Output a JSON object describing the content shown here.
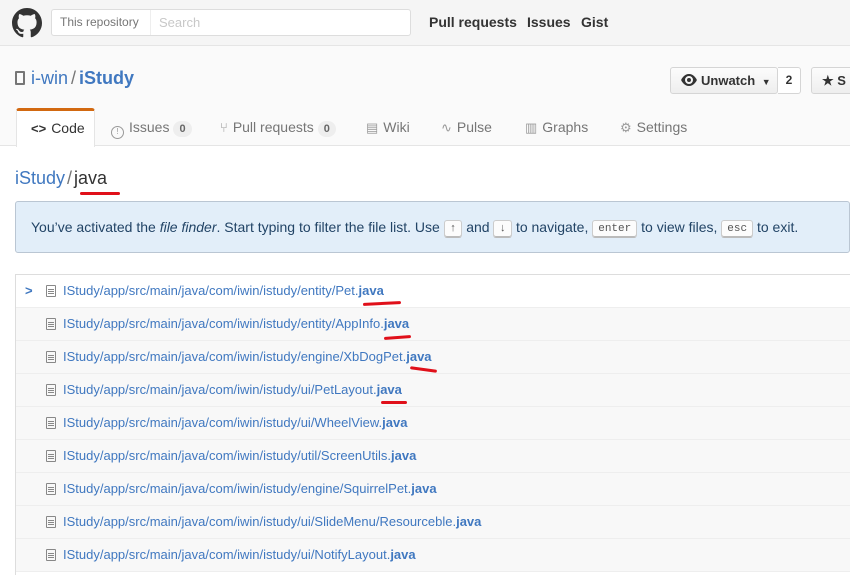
{
  "header": {
    "search_scope": "This repository",
    "search_placeholder": "Search",
    "nav": [
      "Pull requests",
      "Issues",
      "Gist"
    ]
  },
  "repo": {
    "owner": "i-win",
    "separator": "/",
    "name": "iStudy",
    "unwatch_label": "Unwatch",
    "watch_count": "2",
    "star_label": "S"
  },
  "tabs": [
    {
      "label": "Code",
      "icon": "code-icon",
      "selected": true
    },
    {
      "label": "Issues",
      "icon": "issue-icon",
      "count": "0"
    },
    {
      "label": "Pull requests",
      "icon": "pull-request-icon",
      "count": "0"
    },
    {
      "label": "Wiki",
      "icon": "book-icon"
    },
    {
      "label": "Pulse",
      "icon": "pulse-icon"
    },
    {
      "label": "Graphs",
      "icon": "graph-icon"
    },
    {
      "label": "Settings",
      "icon": "gear-icon"
    }
  ],
  "finder": {
    "repo": "iStudy",
    "separator": "/",
    "query": "java"
  },
  "flash": {
    "t1": "You’ve activated the ",
    "t2": "file finder",
    "t3": ". Start typing to filter the file list. Use ",
    "k_up": "↑",
    "t4": " and ",
    "k_down": "↓",
    "t5": " to navigate, ",
    "k_enter": "enter",
    "t6": " to view files, ",
    "k_esc": "esc",
    "t7": " to exit."
  },
  "files": [
    {
      "prefix": "IStudy/app/src/main/java/com/iwin/istudy/entity/Pet.",
      "match": "java"
    },
    {
      "prefix": "IStudy/app/src/main/java/com/iwin/istudy/entity/AppInfo.",
      "match": "java"
    },
    {
      "prefix": "IStudy/app/src/main/java/com/iwin/istudy/engine/XbDogPet.",
      "match": "java"
    },
    {
      "prefix": "IStudy/app/src/main/java/com/iwin/istudy/ui/PetLayout.",
      "match": "java"
    },
    {
      "prefix": "IStudy/app/src/main/java/com/iwin/istudy/ui/WheelView.",
      "match": "java"
    },
    {
      "prefix": "IStudy/app/src/main/java/com/iwin/istudy/util/ScreenUtils.",
      "match": "java"
    },
    {
      "prefix": "IStudy/app/src/main/java/com/iwin/istudy/engine/SquirrelPet.",
      "match": "java"
    },
    {
      "prefix": "IStudy/app/src/main/java/com/iwin/istudy/ui/SlideMenu/Resourceble.",
      "match": "java"
    },
    {
      "prefix": "IStudy/app/src/main/java/com/iwin/istudy/ui/NotifyLayout.",
      "match": "java"
    }
  ],
  "colors": {
    "link": "#4078c0",
    "selected_tab_border": "#d26911",
    "flash_bg": "#e2eef9",
    "annotation": "#e0101a"
  }
}
